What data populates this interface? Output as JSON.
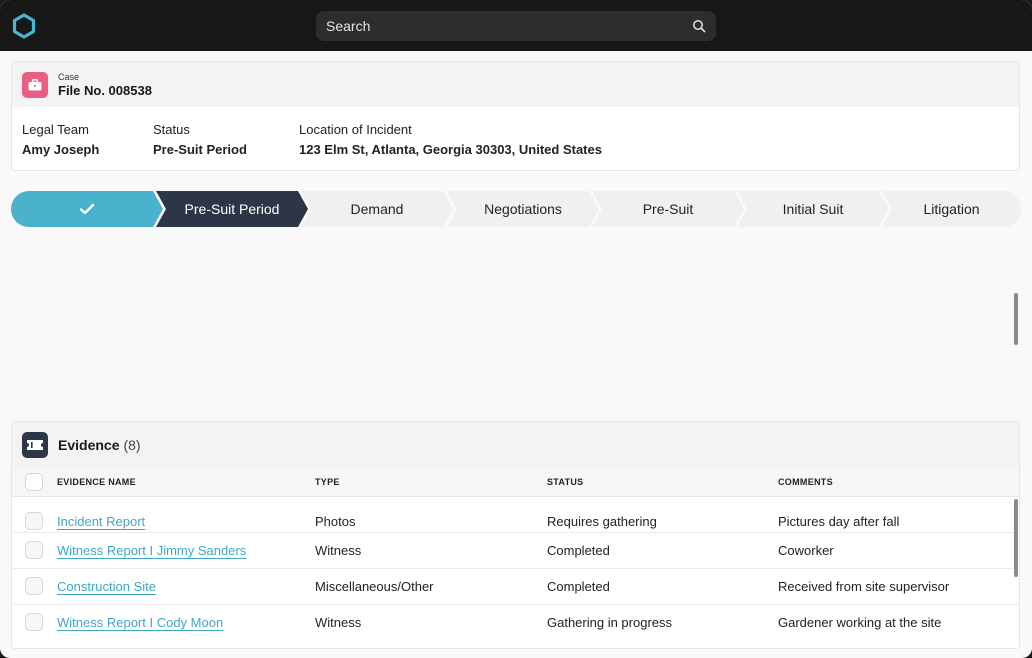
{
  "search": {
    "placeholder": "Search"
  },
  "case": {
    "small_label": "Case",
    "title": "File No. 008538",
    "fields": [
      {
        "label": "Legal Team",
        "value": "Amy Joseph"
      },
      {
        "label": "Status",
        "value": "Pre-Suit Period"
      },
      {
        "label": "Location of Incident",
        "value": "123 Elm St, Atlanta, Georgia 30303, United States"
      }
    ]
  },
  "stepper": {
    "steps": [
      {
        "label": "",
        "state": "completed"
      },
      {
        "label": "Pre-Suit Period",
        "state": "current"
      },
      {
        "label": "Demand",
        "state": "upcoming"
      },
      {
        "label": "Negotiations",
        "state": "upcoming"
      },
      {
        "label": "Pre-Suit",
        "state": "upcoming"
      },
      {
        "label": "Initial Suit",
        "state": "upcoming"
      },
      {
        "label": "Litigation",
        "state": "upcoming"
      }
    ]
  },
  "evidence": {
    "title": "Evidence",
    "count": "(8)",
    "columns": [
      "EVIDENCE NAME",
      "TYPE",
      "STATUS",
      "COMMENTS"
    ],
    "rows": [
      {
        "name": "Incident Report",
        "type": "Photos",
        "status": "Requires gathering",
        "comments": "Pictures day after fall"
      },
      {
        "name": "Witness Report I Jimmy Sanders",
        "type": "Witness",
        "status": "Completed",
        "comments": "Coworker"
      },
      {
        "name": "Construction Site",
        "type": "Miscellaneous/Other",
        "status": "Completed",
        "comments": "Received from site supervisor"
      },
      {
        "name": "Witness Report I Cody Moon",
        "type": "Witness",
        "status": "Gathering in progress",
        "comments": "Gardener working at the site"
      }
    ]
  },
  "colors": {
    "completed": "#4ab2cd",
    "current": "#2d3646",
    "upcoming": "#f2f2f2",
    "link": "#3ea8c4",
    "case_icon": "#ea5e82"
  },
  "icons": {
    "logo": "hexagon-logo-icon",
    "search": "magnifier-icon",
    "case": "briefcase-icon",
    "evidence": "ticket-icon",
    "check": "checkmark-icon"
  }
}
